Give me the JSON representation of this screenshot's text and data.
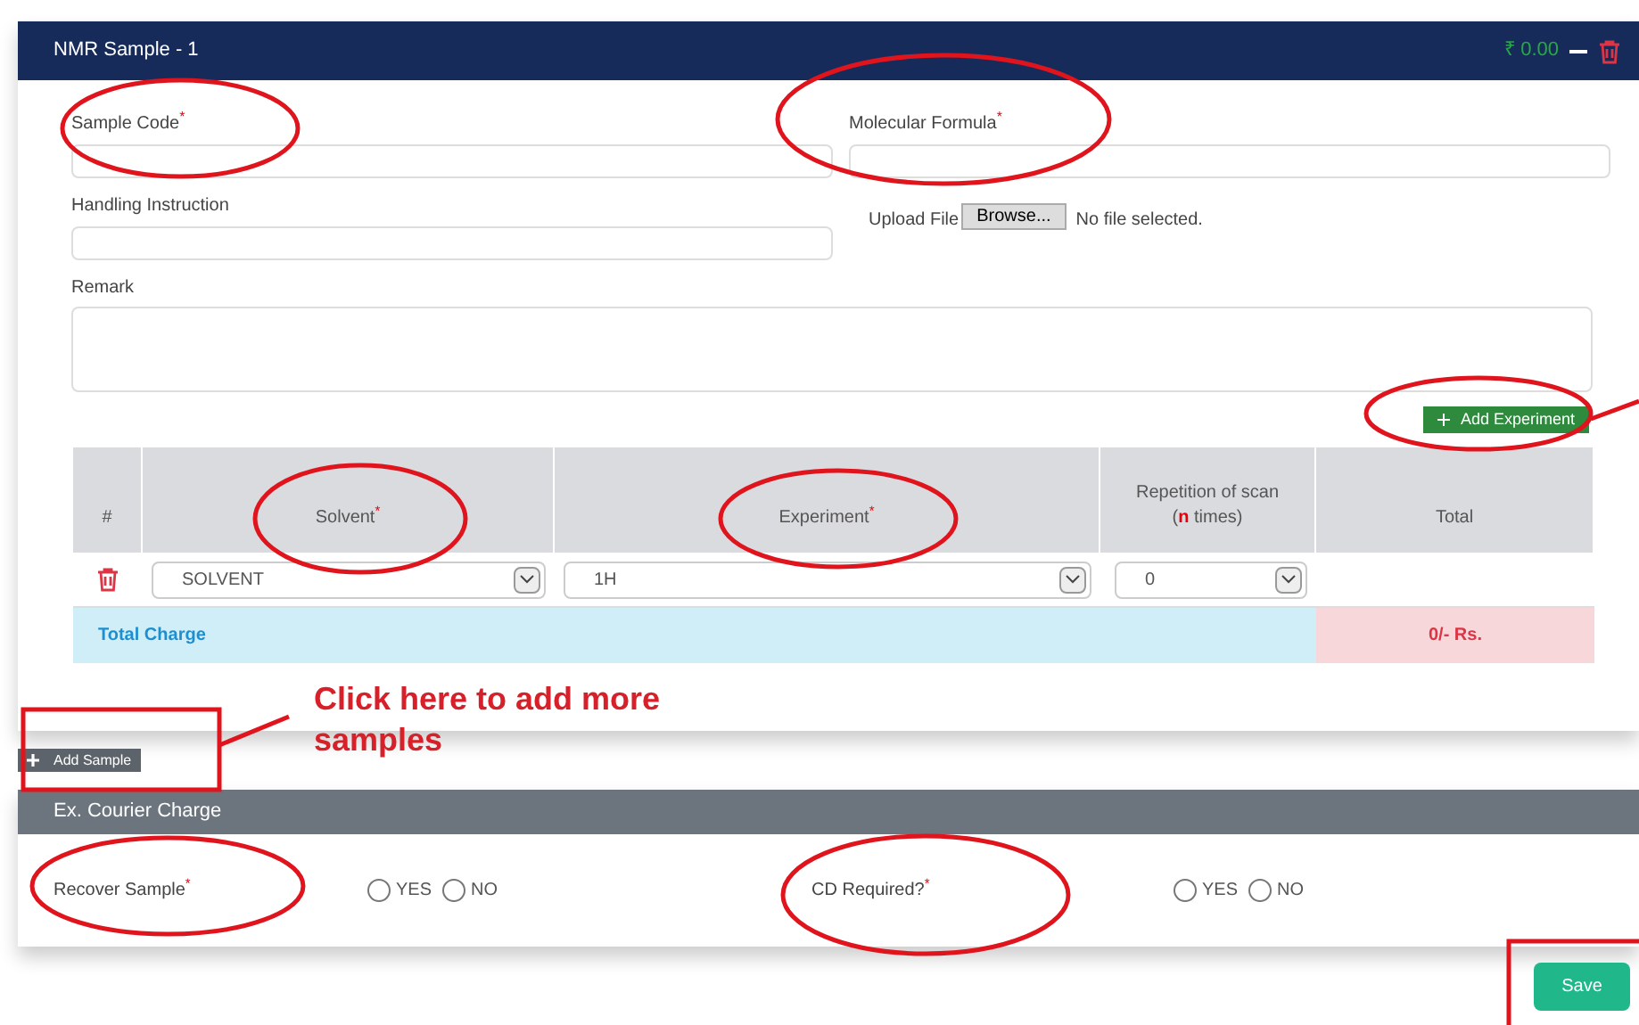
{
  "sample_card": {
    "title": "NMR Sample - 1",
    "amount": "₹ 0.00",
    "fields": [
      {
        "label": "Sample Code$^{*}$",
        "kind": "input"
      },
      {
        "label": "Molecular Formula$^{*}$",
        "kind": "input"
      },
      {
        "label": "Handling Instruction",
        "kind": "input"
      },
      {
        "label": "Upload File",
        "kind": "file",
        "button": "Browse...",
        "status": "No file selected."
      }
    ],
    "remark": {
      "label": "Remark"
    },
    "add_experiment": "Add Experiment",
    "table": {
      "columns": [
        "#",
        "Solvent$^{*}$",
        "Experiment$^{*}$",
        "Repetition of scan (**n** times)",
        "Total"
      ],
      "rows": [
        {
          "solvent": "SOLVENT",
          "experiment": "1H",
          "repetition": "0"
        }
      ],
      "total_label": "Total Charge",
      "total_value": "0/- Rs."
    }
  },
  "add_sample": "Add Sample",
  "courier_card": {
    "title": "Ex. Courier Charge",
    "questions": [
      {
        "label": "Recover Sample$^{*}$",
        "options": [
          {
            "label": "YES",
            "selected": false
          },
          {
            "label": "NO",
            "selected": false
          }
        ]
      },
      {
        "label": "CD Required?$^{*}$",
        "options": [
          {
            "label": "YES",
            "selected": false
          },
          {
            "label": "NO",
            "selected": false
          }
        ]
      }
    ]
  },
  "save": "Save",
  "annotation": {
    "text": "Click here to add more samples"
  }
}
